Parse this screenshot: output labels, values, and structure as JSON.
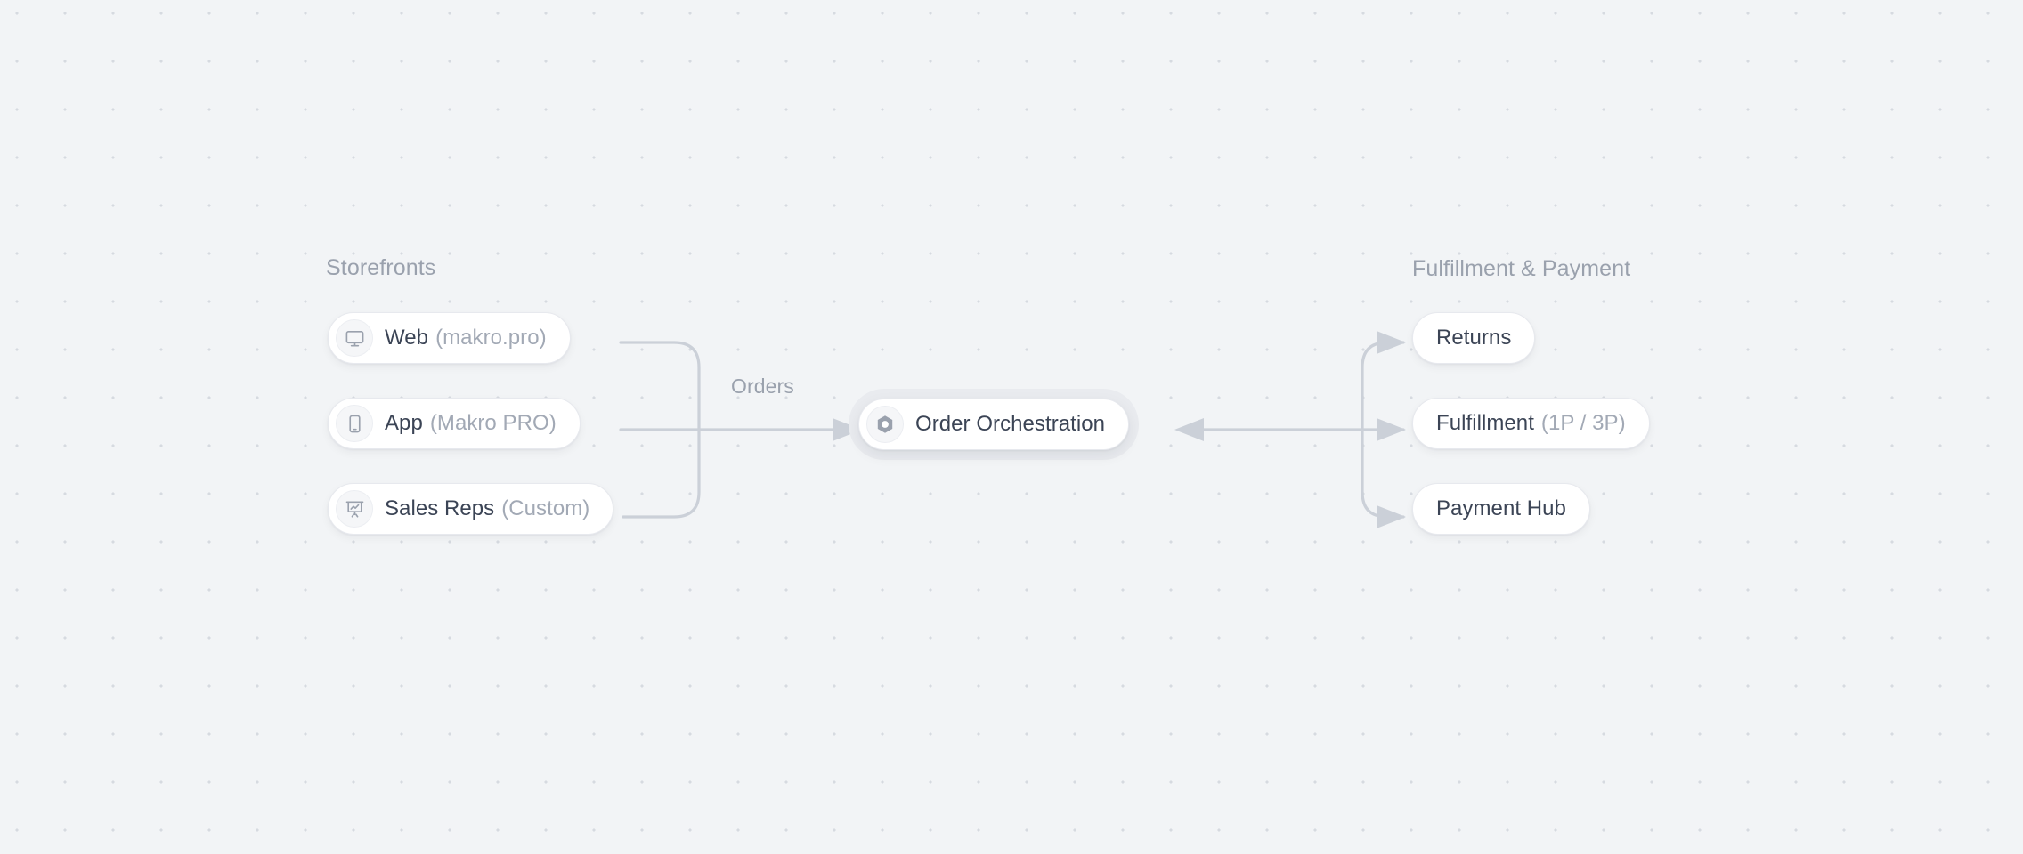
{
  "canvas": {
    "background_color": "#f2f4f6",
    "dot_color": "#d6dae0",
    "edge_color": "#cbd0d8",
    "accent_text_color": "#3b4455",
    "muted_text_color": "#9aa1ad"
  },
  "columns": {
    "left": {
      "heading": "Storefronts"
    },
    "right": {
      "heading": "Fulfillment & Payment"
    }
  },
  "storefronts": [
    {
      "icon": "monitor-icon",
      "label": "Web",
      "sub": "(makro.pro)"
    },
    {
      "icon": "smartphone-icon",
      "label": "App",
      "sub": "(Makro PRO)"
    },
    {
      "icon": "presentation-icon",
      "label": "Sales Reps",
      "sub": "(Custom)"
    }
  ],
  "hub": {
    "icon": "hex-nut-icon",
    "label": "Order Orchestration",
    "sub": ""
  },
  "fulfillment": [
    {
      "label": "Returns",
      "sub": ""
    },
    {
      "label": "Fulfillment",
      "sub": "(1P / 3P)"
    },
    {
      "label": "Payment Hub",
      "sub": ""
    }
  ],
  "edges": {
    "orders_label": "Orders"
  }
}
